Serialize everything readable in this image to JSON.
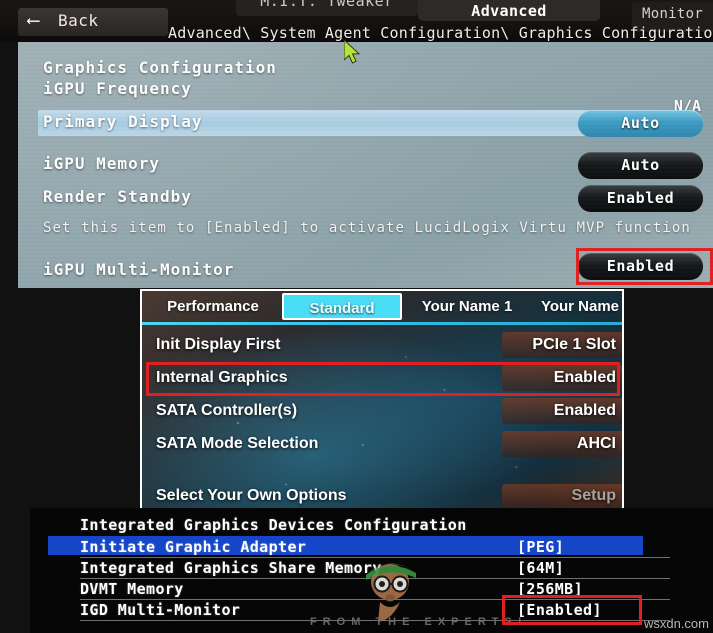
{
  "topbar": {
    "back_label": "Back",
    "back_icon": "back-arrow-icon",
    "tab_tweaker": "M.I.T. Tweaker",
    "tab_advanced": "Advanced",
    "tab_monitor": "Monitor",
    "breadcrumb": "Advanced\\ System Agent Configuration\\ Graphics Configuration"
  },
  "top_panel": {
    "heading": "Graphics Configuration",
    "subheading": "iGPU Frequency",
    "na_value": "N/A",
    "hint": "Set this item to [Enabled] to activate LucidLogix Virtu MVP function",
    "rows": [
      {
        "label": "Primary Display",
        "value": "Auto",
        "selected": true,
        "highlighted": true,
        "boxed": false
      },
      {
        "label": "iGPU Memory",
        "value": "Auto",
        "selected": false,
        "highlighted": false,
        "boxed": false
      },
      {
        "label": "Render Standby",
        "value": "Enabled",
        "selected": false,
        "highlighted": false,
        "boxed": false
      },
      {
        "label": "iGPU Multi-Monitor",
        "value": "Enabled",
        "selected": false,
        "highlighted": false,
        "boxed": true
      }
    ]
  },
  "mid_panel": {
    "tabs": [
      {
        "label": "Performance",
        "active": false
      },
      {
        "label": "Standard",
        "active": true
      },
      {
        "label": "Your Name 1",
        "active": false
      },
      {
        "label": "Your Name",
        "active": false
      }
    ],
    "rows": [
      {
        "label": "Init Display First",
        "value": "PCIe 1 Slot",
        "boxed": false,
        "dim": false
      },
      {
        "label": "Internal Graphics",
        "value": "Enabled",
        "boxed": true,
        "dim": false
      },
      {
        "label": "SATA Controller(s)",
        "value": "Enabled",
        "boxed": false,
        "dim": false
      },
      {
        "label": "SATA Mode Selection",
        "value": "AHCI",
        "boxed": false,
        "dim": false
      },
      {
        "label": "Select Your Own Options",
        "value": "Setup",
        "boxed": false,
        "dim": true
      }
    ]
  },
  "bottom_panel": {
    "heading": "Integrated Graphics Devices Configuration",
    "rows": [
      {
        "label": "Initiate Graphic Adapter",
        "value": "[PEG]",
        "selected": true,
        "boxed": false
      },
      {
        "label": "Integrated Graphics Share Memory",
        "value": "[64M]",
        "selected": false,
        "boxed": false
      },
      {
        "label": "DVMT Memory",
        "value": "[256MB]",
        "selected": false,
        "boxed": false
      },
      {
        "label": "IGD Multi-Monitor",
        "value": "[Enabled]",
        "selected": false,
        "boxed": true
      }
    ]
  },
  "watermark": {
    "tagline": "FROM THE EXPERTS!",
    "site": "wsxdn.com"
  },
  "colors": {
    "accent_red": "#e02020",
    "accent_cyan": "#4adef6",
    "select_blue": "#1646c8",
    "highlight_blue": "#a9cde2"
  }
}
